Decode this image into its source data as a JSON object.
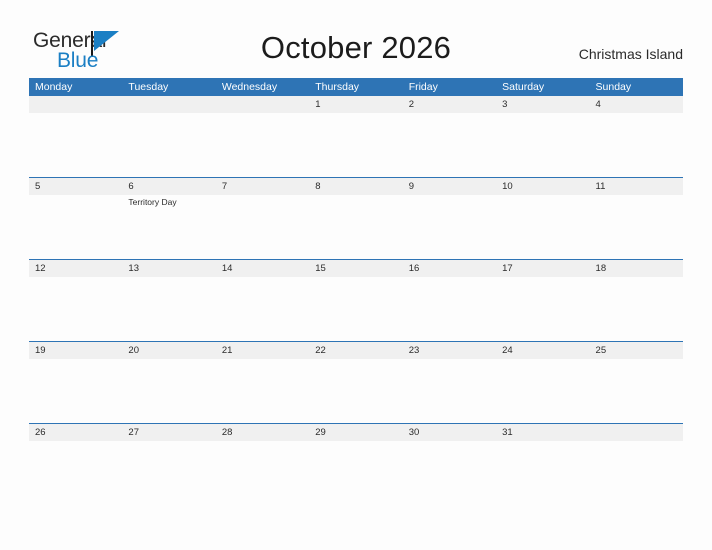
{
  "brand": {
    "name_part1": "General",
    "name_part2": "Blue",
    "flag_icon": "flag-triangle-icon",
    "accent_color": "#1b7fc4"
  },
  "header": {
    "title": "October 2026",
    "region": "Christmas Island"
  },
  "calendar": {
    "header_color": "#2e74b5",
    "band_color": "#f0f0f0",
    "weekdays": [
      "Monday",
      "Tuesday",
      "Wednesday",
      "Thursday",
      "Friday",
      "Saturday",
      "Sunday"
    ],
    "weeks": [
      {
        "days": [
          {
            "num": "",
            "events": []
          },
          {
            "num": "",
            "events": []
          },
          {
            "num": "",
            "events": []
          },
          {
            "num": "1",
            "events": []
          },
          {
            "num": "2",
            "events": []
          },
          {
            "num": "3",
            "events": []
          },
          {
            "num": "4",
            "events": []
          }
        ]
      },
      {
        "days": [
          {
            "num": "5",
            "events": []
          },
          {
            "num": "6",
            "events": [
              "Territory Day"
            ]
          },
          {
            "num": "7",
            "events": []
          },
          {
            "num": "8",
            "events": []
          },
          {
            "num": "9",
            "events": []
          },
          {
            "num": "10",
            "events": []
          },
          {
            "num": "11",
            "events": []
          }
        ]
      },
      {
        "days": [
          {
            "num": "12",
            "events": []
          },
          {
            "num": "13",
            "events": []
          },
          {
            "num": "14",
            "events": []
          },
          {
            "num": "15",
            "events": []
          },
          {
            "num": "16",
            "events": []
          },
          {
            "num": "17",
            "events": []
          },
          {
            "num": "18",
            "events": []
          }
        ]
      },
      {
        "days": [
          {
            "num": "19",
            "events": []
          },
          {
            "num": "20",
            "events": []
          },
          {
            "num": "21",
            "events": []
          },
          {
            "num": "22",
            "events": []
          },
          {
            "num": "23",
            "events": []
          },
          {
            "num": "24",
            "events": []
          },
          {
            "num": "25",
            "events": []
          }
        ]
      },
      {
        "days": [
          {
            "num": "26",
            "events": []
          },
          {
            "num": "27",
            "events": []
          },
          {
            "num": "28",
            "events": []
          },
          {
            "num": "29",
            "events": []
          },
          {
            "num": "30",
            "events": []
          },
          {
            "num": "31",
            "events": []
          },
          {
            "num": "",
            "events": []
          }
        ]
      }
    ]
  }
}
